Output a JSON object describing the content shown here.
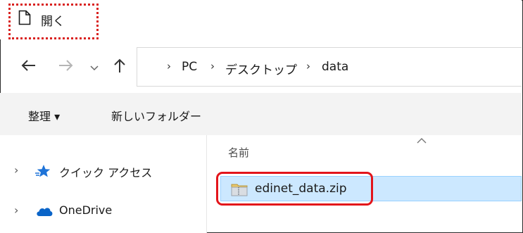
{
  "dialog": {
    "title": "開く"
  },
  "nav": {
    "back_icon": "arrow-left-icon",
    "forward_icon": "arrow-right-icon",
    "recent_icon": "chevron-down-icon",
    "up_icon": "arrow-up-icon"
  },
  "breadcrumb": {
    "items": [
      "PC",
      "デスクトップ",
      "data"
    ]
  },
  "toolbar": {
    "organize_label": "整理 ▾",
    "new_folder_label": "新しいフォルダー"
  },
  "sidebar": {
    "items": [
      {
        "label": "クイック アクセス",
        "icon": "star-icon"
      },
      {
        "label": "OneDrive",
        "icon": "cloud-icon"
      }
    ]
  },
  "file_list": {
    "column_header": "名前",
    "files": [
      {
        "name": "edinet_data.zip",
        "icon": "zip-folder-icon",
        "selected": true
      }
    ]
  },
  "colors": {
    "accent": "#cce8ff",
    "highlight": "#e3151b",
    "star": "#1e73d8",
    "cloud": "#0a64c8"
  }
}
